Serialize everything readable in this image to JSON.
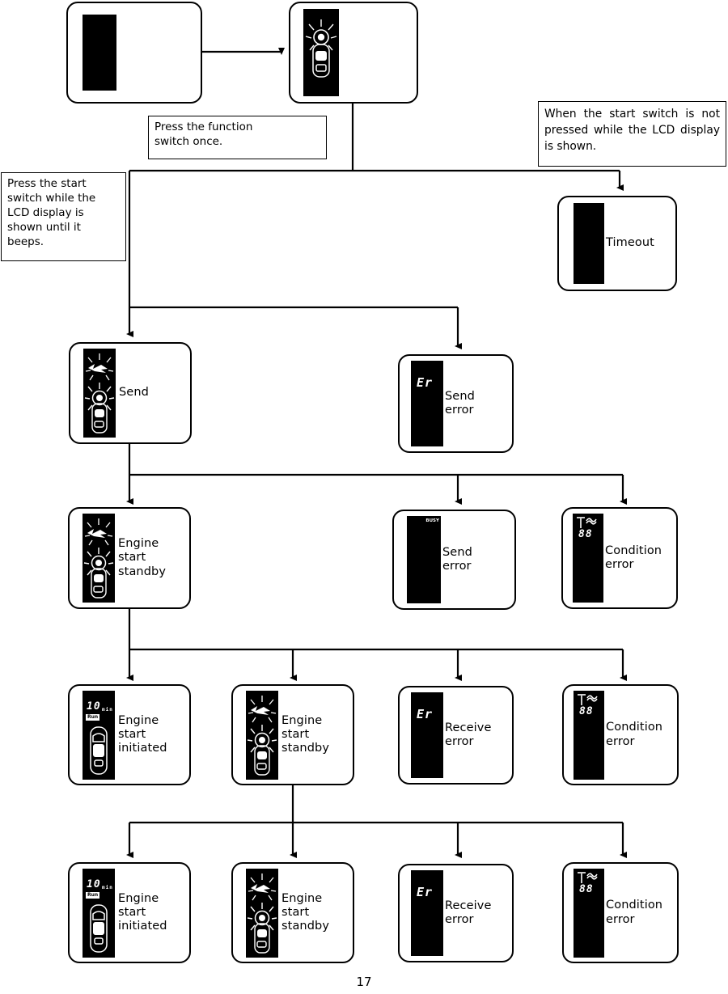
{
  "page": {
    "number": "17"
  },
  "notes": [
    {
      "id": "press-function-switch",
      "text": "Press the function\nswitch once."
    },
    {
      "id": "press-start-switch",
      "text": "Press the start\nswitch while the\nLCD display is\nshown until it\nbeeps."
    },
    {
      "id": "start-switch-not-pressed",
      "text": "When the start switch is not pressed while the LCD display is shown."
    }
  ],
  "nodes": {
    "initial": {
      "label": "",
      "lcd": "blank"
    },
    "lcd_shown": {
      "label": "",
      "lcd": "car-burst"
    },
    "timeout": {
      "label": "Timeout",
      "lcd": "blank"
    },
    "send": {
      "label": "Send",
      "lcd": "send-car-burst"
    },
    "send_error_1": {
      "label": "Send\nerror",
      "lcd": "er"
    },
    "engine_start_standby_1": {
      "label": "Engine\nstart\nstandby",
      "lcd": "send-car-burst"
    },
    "send_error_2": {
      "label": "Send\nerror",
      "lcd": "busy"
    },
    "condition_error_1": {
      "label": "Condition\nerror",
      "lcd": "antenna-88"
    },
    "engine_start_initiated_1": {
      "label": "Engine\nstart\ninitiated",
      "lcd": "run-10min"
    },
    "engine_start_standby_2": {
      "label": "Engine\nstart\nstandby",
      "lcd": "send-car-burst"
    },
    "receive_error_1": {
      "label": "Receive\nerror",
      "lcd": "er"
    },
    "condition_error_2": {
      "label": "Condition\nerror",
      "lcd": "antenna-88"
    },
    "engine_start_initiated_2": {
      "label": "Engine\nstart\ninitiated",
      "lcd": "run-10min"
    },
    "engine_start_standby_3": {
      "label": "Engine\nstart\nstandby",
      "lcd": "send-car-burst"
    },
    "receive_error_2": {
      "label": "Receive\nerror",
      "lcd": "er"
    },
    "condition_error_3": {
      "label": "Condition\nerror",
      "lcd": "antenna-88"
    }
  },
  "lcd_glyphs": {
    "er": "Er",
    "digits_88": "88",
    "minutes": "10",
    "minutes_unit": "min",
    "run": "Run",
    "busy": "BUSY"
  },
  "colors": {
    "line": "#000000",
    "lcd_background": "#000000",
    "lcd_foreground": "#ffffff",
    "page_background": "#ffffff"
  }
}
